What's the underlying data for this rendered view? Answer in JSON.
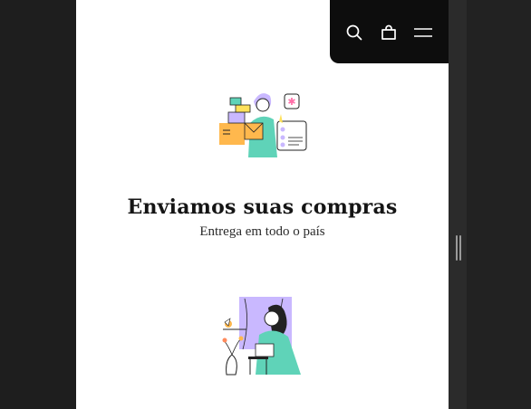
{
  "header": {
    "icons": [
      "search-icon",
      "bag-icon",
      "menu-icon"
    ]
  },
  "features": [
    {
      "icon": "delivery-illustration",
      "title": "Enviamos suas compras",
      "subtitle": "Entrega em todo o país"
    },
    {
      "icon": "support-illustration",
      "title": "",
      "subtitle": ""
    }
  ],
  "colors": {
    "navbar": "#0d0d0d",
    "page": "#ffffff",
    "backdrop": "#1e1e1e",
    "accent_purple": "#c9b8ff",
    "accent_teal": "#5fd3b8",
    "accent_orange": "#ffb84d"
  }
}
